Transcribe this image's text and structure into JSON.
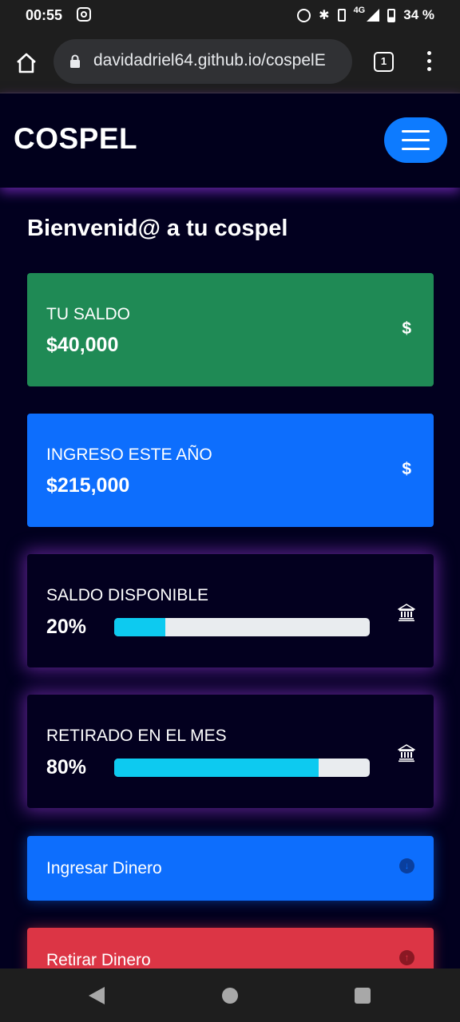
{
  "status_bar": {
    "time": "00:55",
    "network": "4G",
    "battery": "34 %",
    "icons": [
      "instagram-icon",
      "alarm-icon",
      "bluetooth-icon",
      "vibrate-icon",
      "signal-icon",
      "battery-icon"
    ]
  },
  "browser": {
    "url": "davidadriel64.github.io/cospelE",
    "tab_count": "1"
  },
  "app": {
    "brand": "COSPEL",
    "welcome": "Bienvenid@ a tu cospel"
  },
  "cards": {
    "saldo": {
      "label": "TU SALDO",
      "value": "$40,000",
      "icon": "$"
    },
    "ingreso": {
      "label": "INGRESO ESTE AÑO",
      "value": "$215,000",
      "icon": "$"
    },
    "disponible": {
      "label": "SALDO DISPONIBLE",
      "percent": "20%",
      "progress": 0.2
    },
    "retirado": {
      "label": "RETIRADO EN EL MES",
      "percent": "80%",
      "progress": 0.8
    }
  },
  "actions": {
    "ingresar": "Ingresar Dinero",
    "retirar": "Retirar Dinero"
  },
  "colors": {
    "green": "#1f8a55",
    "blue": "#0d6efd",
    "red": "#dc3545",
    "progress": "#0dcaf0",
    "background": "#02001f"
  }
}
